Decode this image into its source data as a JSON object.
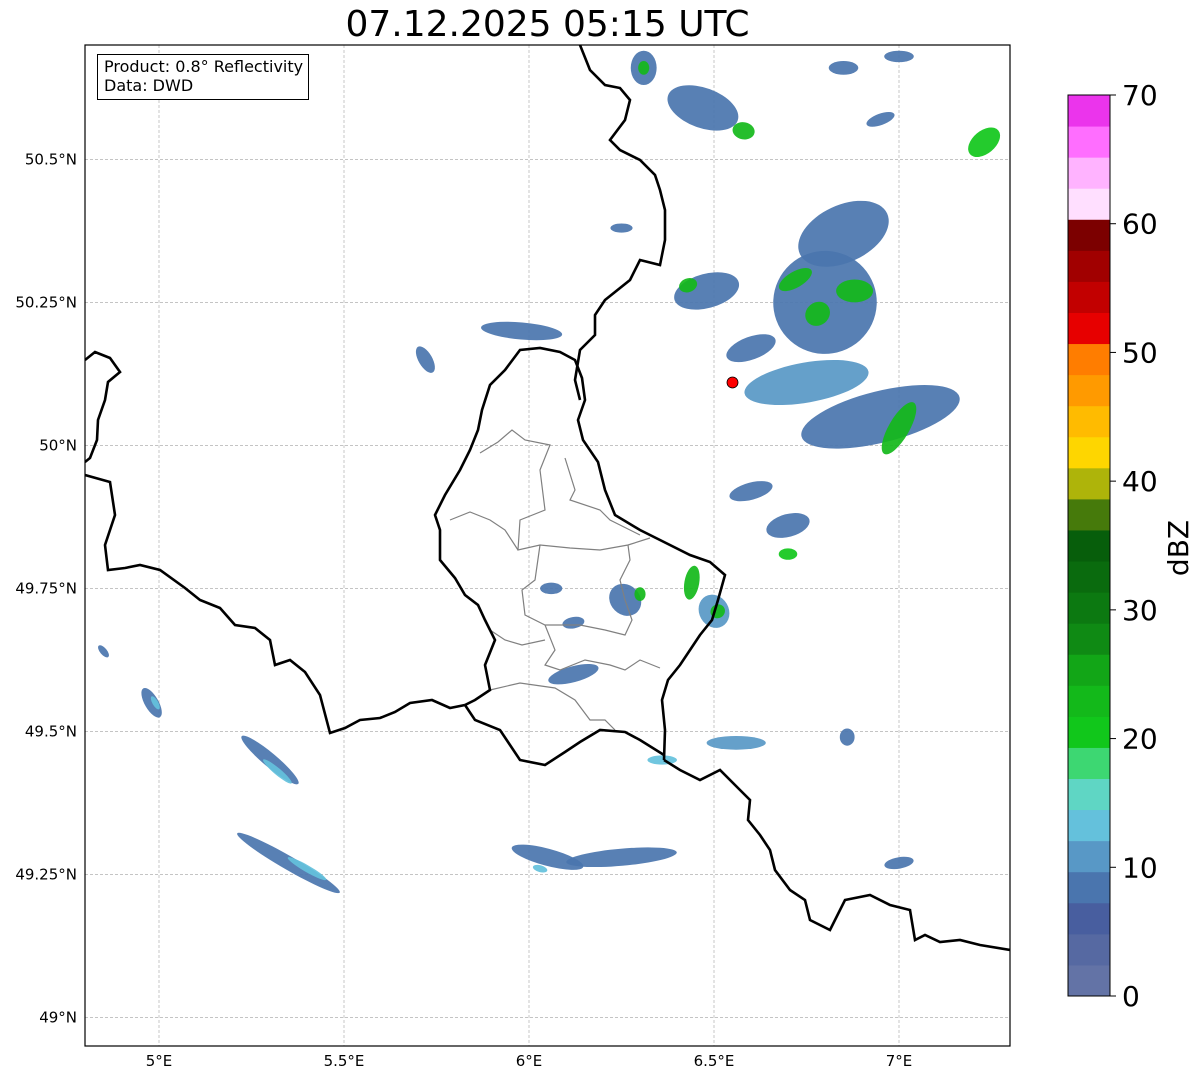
{
  "title": "07.12.2025 05:15 UTC",
  "info": {
    "product": "Product: 0.8° Reflectivity",
    "source": "Data: DWD"
  },
  "map": {
    "lon_range": [
      4.8,
      7.3
    ],
    "lat_range": [
      48.95,
      50.7
    ],
    "lon_ticks": [
      {
        "value": 5.0,
        "label": "5°E"
      },
      {
        "value": 5.5,
        "label": "5.5°E"
      },
      {
        "value": 6.0,
        "label": "6°E"
      },
      {
        "value": 6.5,
        "label": "6.5°E"
      },
      {
        "value": 7.0,
        "label": "7°E"
      }
    ],
    "lat_ticks": [
      {
        "value": 50.5,
        "label": "50.5°N"
      },
      {
        "value": 50.25,
        "label": "50.25°N"
      },
      {
        "value": 50.0,
        "label": "50°N"
      },
      {
        "value": 49.75,
        "label": "49.75°N"
      },
      {
        "value": 49.5,
        "label": "49.5°N"
      },
      {
        "value": 49.25,
        "label": "49.25°N"
      },
      {
        "value": 49.0,
        "label": "49°N"
      }
    ],
    "radar_site": {
      "lon": 6.55,
      "lat": 50.11,
      "color": "#ff0000"
    }
  },
  "colorbar": {
    "label": "dBZ",
    "min": 0,
    "max": 70,
    "ticks": [
      {
        "value": 0,
        "label": "0"
      },
      {
        "value": 10,
        "label": "10"
      },
      {
        "value": 20,
        "label": "20"
      },
      {
        "value": 30,
        "label": "30"
      },
      {
        "value": 40,
        "label": "40"
      },
      {
        "value": 50,
        "label": "50"
      },
      {
        "value": 60,
        "label": "60"
      },
      {
        "value": 70,
        "label": "70"
      }
    ],
    "colors": [
      "#6373a6",
      "#5669a2",
      "#485e9f",
      "#4a75ae",
      "#5898c6",
      "#64c1dc",
      "#5fd6c4",
      "#3dd772",
      "#11c71b",
      "#13b91a",
      "#12a617",
      "#0f8a14",
      "#0c7911",
      "#0a6b0e",
      "#075e0b",
      "#467a0b",
      "#aeb40a",
      "#fed600",
      "#ffbb00",
      "#ff9a00",
      "#ff7d00",
      "#e70000",
      "#c20000",
      "#a10000",
      "#7c0000",
      "#ffdfff",
      "#ffb3ff",
      "#ff6eff",
      "#eb34ec"
    ]
  },
  "echoes": [
    {
      "lon": 6.95,
      "lat": 50.05,
      "rx": 0.22,
      "ry": 0.045,
      "rot": -14,
      "level": 3
    },
    {
      "lon": 7.0,
      "lat": 50.03,
      "rx": 0.08,
      "ry": 0.018,
      "rot": -60,
      "level": 9
    },
    {
      "lon": 6.75,
      "lat": 50.11,
      "rx": 0.17,
      "ry": 0.035,
      "rot": -10,
      "level": 4
    },
    {
      "lon": 6.8,
      "lat": 50.25,
      "rx": 0.14,
      "ry": 0.09,
      "rot": -20,
      "level": 3
    },
    {
      "lon": 6.72,
      "lat": 50.29,
      "rx": 0.05,
      "ry": 0.014,
      "rot": -30,
      "level": 9
    },
    {
      "lon": 6.78,
      "lat": 50.23,
      "rx": 0.035,
      "ry": 0.02,
      "rot": -40,
      "level": 9
    },
    {
      "lon": 6.85,
      "lat": 50.37,
      "rx": 0.13,
      "ry": 0.05,
      "rot": -25,
      "level": 3
    },
    {
      "lon": 6.88,
      "lat": 50.27,
      "rx": 0.05,
      "ry": 0.02,
      "rot": 0,
      "level": 9
    },
    {
      "lon": 6.6,
      "lat": 50.17,
      "rx": 0.07,
      "ry": 0.02,
      "rot": -20,
      "level": 3
    },
    {
      "lon": 6.48,
      "lat": 50.27,
      "rx": 0.09,
      "ry": 0.03,
      "rot": -15,
      "level": 3
    },
    {
      "lon": 6.43,
      "lat": 50.28,
      "rx": 0.025,
      "ry": 0.012,
      "rot": -20,
      "level": 9
    },
    {
      "lon": 6.47,
      "lat": 50.59,
      "rx": 0.1,
      "ry": 0.035,
      "rot": 20,
      "level": 3
    },
    {
      "lon": 6.58,
      "lat": 50.55,
      "rx": 0.03,
      "ry": 0.015,
      "rot": 10,
      "level": 9
    },
    {
      "lon": 6.31,
      "lat": 50.66,
      "rx": 0.035,
      "ry": 0.03,
      "rot": 0,
      "level": 3
    },
    {
      "lon": 6.31,
      "lat": 50.66,
      "rx": 0.015,
      "ry": 0.012,
      "rot": 0,
      "level": 9
    },
    {
      "lon": 6.85,
      "lat": 50.66,
      "rx": 0.04,
      "ry": 0.012,
      "rot": 0,
      "level": 3
    },
    {
      "lon": 7.0,
      "lat": 50.68,
      "rx": 0.04,
      "ry": 0.01,
      "rot": 0,
      "level": 3
    },
    {
      "lon": 7.23,
      "lat": 50.53,
      "rx": 0.05,
      "ry": 0.02,
      "rot": -40,
      "level": 8
    },
    {
      "lon": 6.6,
      "lat": 49.92,
      "rx": 0.06,
      "ry": 0.015,
      "rot": -15,
      "level": 3
    },
    {
      "lon": 6.7,
      "lat": 49.86,
      "rx": 0.06,
      "ry": 0.02,
      "rot": -15,
      "level": 3
    },
    {
      "lon": 6.7,
      "lat": 49.81,
      "rx": 0.025,
      "ry": 0.01,
      "rot": 0,
      "level": 8
    },
    {
      "lon": 6.26,
      "lat": 49.73,
      "rx": 0.04,
      "ry": 0.03,
      "rot": -45,
      "level": 3
    },
    {
      "lon": 6.3,
      "lat": 49.74,
      "rx": 0.015,
      "ry": 0.012,
      "rot": 0,
      "level": 9
    },
    {
      "lon": 6.44,
      "lat": 49.76,
      "rx": 0.02,
      "ry": 0.03,
      "rot": 10,
      "level": 9
    },
    {
      "lon": 6.5,
      "lat": 49.71,
      "rx": 0.04,
      "ry": 0.03,
      "rot": -30,
      "level": 4
    },
    {
      "lon": 6.51,
      "lat": 49.71,
      "rx": 0.02,
      "ry": 0.012,
      "rot": -30,
      "level": 9
    },
    {
      "lon": 6.12,
      "lat": 49.6,
      "rx": 0.07,
      "ry": 0.014,
      "rot": -15,
      "level": 3
    },
    {
      "lon": 6.12,
      "lat": 49.69,
      "rx": 0.03,
      "ry": 0.01,
      "rot": -10,
      "level": 3
    },
    {
      "lon": 6.06,
      "lat": 49.75,
      "rx": 0.03,
      "ry": 0.01,
      "rot": 0,
      "level": 3
    },
    {
      "lon": 6.56,
      "lat": 49.48,
      "rx": 0.08,
      "ry": 0.012,
      "rot": 0,
      "level": 4
    },
    {
      "lon": 6.36,
      "lat": 49.45,
      "rx": 0.04,
      "ry": 0.008,
      "rot": 0,
      "level": 5
    },
    {
      "lon": 6.86,
      "lat": 49.49,
      "rx": 0.02,
      "ry": 0.015,
      "rot": 0,
      "level": 3
    },
    {
      "lon": 7.0,
      "lat": 49.27,
      "rx": 0.04,
      "ry": 0.01,
      "rot": -10,
      "level": 3
    },
    {
      "lon": 6.25,
      "lat": 49.28,
      "rx": 0.15,
      "ry": 0.015,
      "rot": -5,
      "level": 3
    },
    {
      "lon": 6.05,
      "lat": 49.28,
      "rx": 0.1,
      "ry": 0.015,
      "rot": 15,
      "level": 3
    },
    {
      "lon": 6.03,
      "lat": 49.26,
      "rx": 0.02,
      "ry": 0.006,
      "rot": 15,
      "level": 5
    },
    {
      "lon": 5.35,
      "lat": 49.27,
      "rx": 0.16,
      "ry": 0.012,
      "rot": 30,
      "level": 3
    },
    {
      "lon": 5.4,
      "lat": 49.26,
      "rx": 0.06,
      "ry": 0.006,
      "rot": 30,
      "level": 5
    },
    {
      "lon": 5.3,
      "lat": 49.45,
      "rx": 0.1,
      "ry": 0.012,
      "rot": 40,
      "level": 3
    },
    {
      "lon": 5.32,
      "lat": 49.43,
      "rx": 0.05,
      "ry": 0.006,
      "rot": 40,
      "level": 5
    },
    {
      "lon": 4.98,
      "lat": 49.55,
      "rx": 0.045,
      "ry": 0.012,
      "rot": 60,
      "level": 3
    },
    {
      "lon": 4.99,
      "lat": 49.55,
      "rx": 0.02,
      "ry": 0.005,
      "rot": 60,
      "level": 5
    },
    {
      "lon": 4.85,
      "lat": 49.64,
      "rx": 0.02,
      "ry": 0.006,
      "rot": 50,
      "level": 3
    },
    {
      "lon": 5.98,
      "lat": 50.2,
      "rx": 0.11,
      "ry": 0.015,
      "rot": 5,
      "level": 3
    },
    {
      "lon": 5.72,
      "lat": 50.15,
      "rx": 0.04,
      "ry": 0.012,
      "rot": 60,
      "level": 3
    },
    {
      "lon": 6.25,
      "lat": 50.38,
      "rx": 0.03,
      "ry": 0.008,
      "rot": 0,
      "level": 3
    },
    {
      "lon": 6.95,
      "lat": 50.57,
      "rx": 0.04,
      "ry": 0.01,
      "rot": -20,
      "level": 3
    }
  ]
}
